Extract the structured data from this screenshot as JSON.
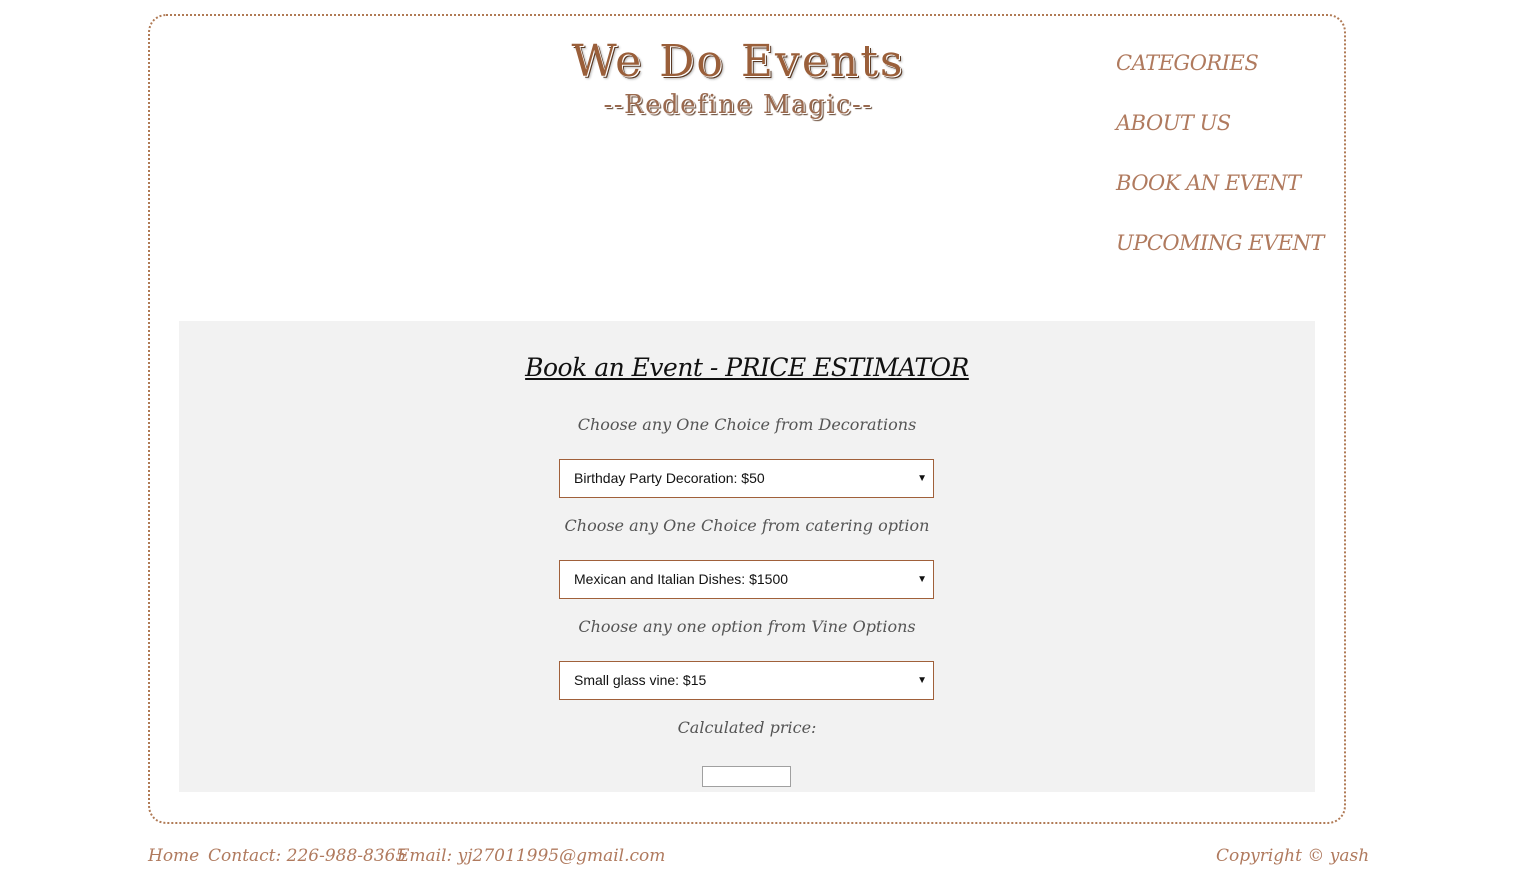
{
  "header": {
    "title": "We Do Events",
    "subtitle": "--Redefine Magic--"
  },
  "nav": {
    "items": [
      {
        "label": "CATEGORIES"
      },
      {
        "label": "ABOUT US"
      },
      {
        "label": "BOOK AN EVENT"
      },
      {
        "label": "UPCOMING EVENT"
      }
    ]
  },
  "estimator": {
    "title": "Book an Event - PRICE ESTIMATOR",
    "decorations_label": "Choose any One Choice from Decorations",
    "decorations_value": "Birthday Party Decoration: $50",
    "catering_label": "Choose any One Choice from catering option",
    "catering_value": "Mexican and Italian Dishes: $1500",
    "vine_label": "Choose any one option from Vine Options",
    "vine_value": "Small glass vine: $15",
    "price_label": "Calculated price:",
    "price_value": ""
  },
  "footer": {
    "home": "Home",
    "contact": "Contact: 226-988-8365",
    "email": "Email: yj27011995@gmail.com",
    "copyright": "Copyright © yash"
  },
  "colors": {
    "accent": "#b07a5e",
    "panel_bg": "#f2f2f2",
    "frame_border": "#b07a55"
  }
}
